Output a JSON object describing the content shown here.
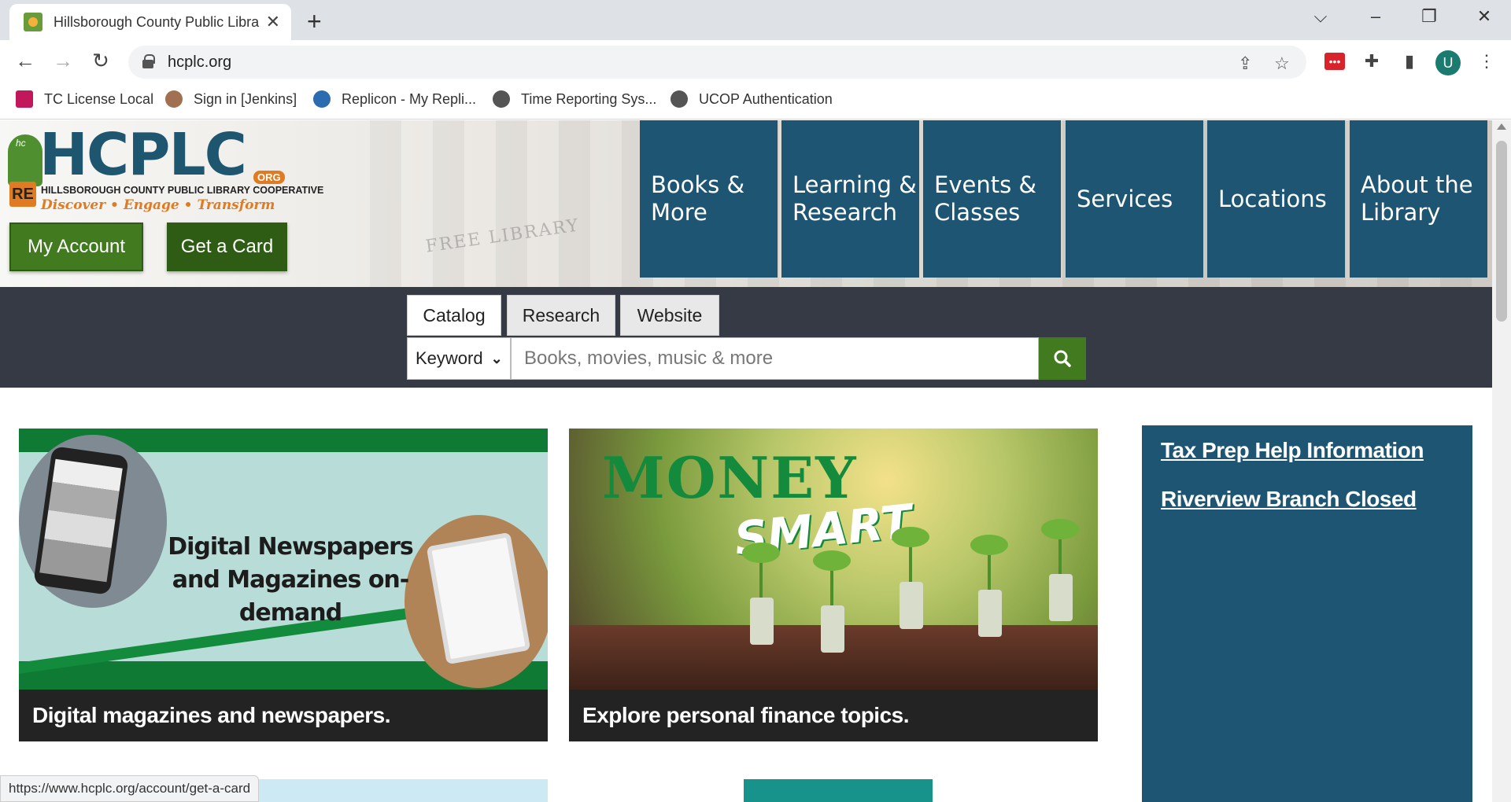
{
  "browser": {
    "tab_title": "Hillsborough County Public Libra",
    "url": "hcplc.org",
    "status_url": "https://www.hcplc.org/account/get-a-card",
    "profile_initial": "U",
    "bookmarks": [
      {
        "label": "TC License Local",
        "color": "#c2185b"
      },
      {
        "label": "Sign in [Jenkins]",
        "color": "#a07050"
      },
      {
        "label": "Replicon - My Repli...",
        "color": "#2b6cb0"
      },
      {
        "label": "Time Reporting Sys...",
        "color": "#555555"
      },
      {
        "label": "UCOP Authentication",
        "color": "#555555"
      }
    ]
  },
  "site": {
    "logo": {
      "name": "HCPLC",
      "org_badge": "ORG",
      "subtitle": "HILLSBOROUGH COUNTY PUBLIC LIBRARY COOPERATIVE",
      "tagline": "Discover • Engage • Transform"
    },
    "my_account": "My Account",
    "get_card": "Get a Card",
    "nav": [
      "Books & More",
      "Learning & Research",
      "Events & Classes",
      "Services",
      "Locations",
      "About the Library"
    ],
    "hero_watermark": "FREE LIBRARY",
    "search": {
      "tabs": [
        "Catalog",
        "Research",
        "Website"
      ],
      "active_tab": "Catalog",
      "scope": "Keyword",
      "placeholder": "Books, movies, music & more"
    },
    "cards": [
      {
        "image_text": "Digital Newspapers and Magazines on-demand",
        "caption": "Digital magazines and newspapers."
      },
      {
        "image_title_1": "MONEY",
        "image_title_2": "SMART",
        "caption": "Explore personal finance topics."
      }
    ],
    "alerts": [
      "Tax Prep Help Information",
      "Riverview Branch Closed"
    ]
  },
  "colors": {
    "brand_blue": "#1d5573",
    "brand_green": "#417a1f",
    "brand_orange": "#e07b22",
    "search_bg": "#363a44"
  }
}
